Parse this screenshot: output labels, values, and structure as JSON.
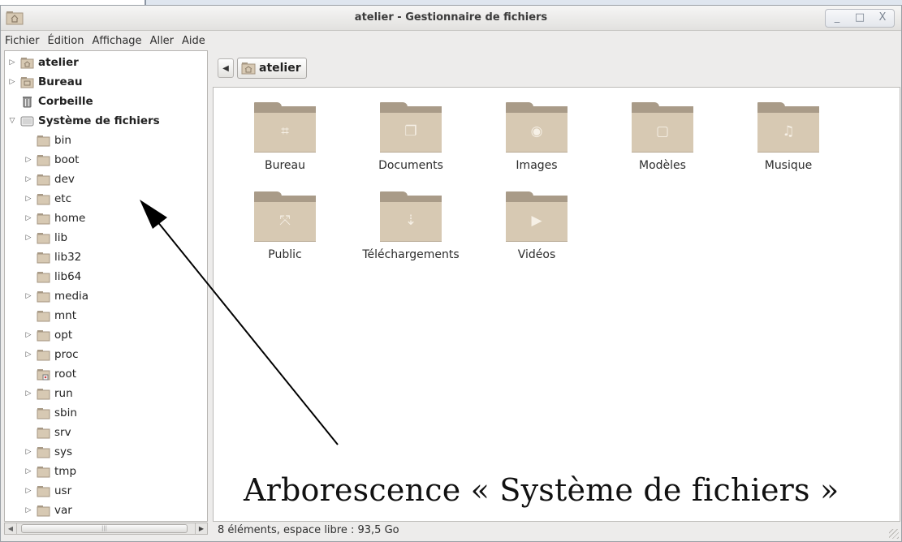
{
  "window": {
    "title": "atelier - Gestionnaire de fichiers",
    "buttons": [
      "_",
      "□",
      "X"
    ]
  },
  "menu": [
    "Fichier",
    "Édition",
    "Affichage",
    "Aller",
    "Aide"
  ],
  "tree": [
    {
      "label": "atelier",
      "expander": "▷",
      "bold": true,
      "icon": "home-folder-icon"
    },
    {
      "label": "Bureau",
      "expander": "▷",
      "bold": true,
      "icon": "desktop-folder-icon"
    },
    {
      "label": "Corbeille",
      "expander": "",
      "bold": true,
      "icon": "trash-icon"
    },
    {
      "label": "Système de fichiers",
      "expander": "▽",
      "bold": true,
      "icon": "drive-icon"
    },
    {
      "label": "bin",
      "expander": "",
      "icon": "folder-icon"
    },
    {
      "label": "boot",
      "expander": "▷",
      "icon": "folder-icon"
    },
    {
      "label": "dev",
      "expander": "▷",
      "icon": "folder-icon"
    },
    {
      "label": "etc",
      "expander": "▷",
      "icon": "folder-icon"
    },
    {
      "label": "home",
      "expander": "▷",
      "icon": "folder-icon"
    },
    {
      "label": "lib",
      "expander": "▷",
      "icon": "folder-icon"
    },
    {
      "label": "lib32",
      "expander": "",
      "icon": "folder-icon"
    },
    {
      "label": "lib64",
      "expander": "",
      "icon": "folder-icon"
    },
    {
      "label": "media",
      "expander": "▷",
      "icon": "folder-icon"
    },
    {
      "label": "mnt",
      "expander": "",
      "icon": "folder-icon"
    },
    {
      "label": "opt",
      "expander": "▷",
      "icon": "folder-icon"
    },
    {
      "label": "proc",
      "expander": "▷",
      "icon": "folder-icon"
    },
    {
      "label": "root",
      "expander": "",
      "icon": "locked-folder-icon"
    },
    {
      "label": "run",
      "expander": "▷",
      "icon": "folder-icon"
    },
    {
      "label": "sbin",
      "expander": "",
      "icon": "folder-icon"
    },
    {
      "label": "srv",
      "expander": "",
      "icon": "folder-icon"
    },
    {
      "label": "sys",
      "expander": "▷",
      "icon": "folder-icon"
    },
    {
      "label": "tmp",
      "expander": "▷",
      "icon": "folder-icon"
    },
    {
      "label": "usr",
      "expander": "▷",
      "icon": "folder-icon"
    },
    {
      "label": "var",
      "expander": "▷",
      "icon": "folder-icon"
    }
  ],
  "pathbar": {
    "back": "◀",
    "current": "atelier"
  },
  "files": [
    {
      "label": "Bureau",
      "emblem": "⌗",
      "icon": "desktop-folder-icon"
    },
    {
      "label": "Documents",
      "emblem": "❐",
      "icon": "documents-folder-icon"
    },
    {
      "label": "Images",
      "emblem": "◉",
      "icon": "pictures-folder-icon"
    },
    {
      "label": "Modèles",
      "emblem": "▢",
      "icon": "templates-folder-icon"
    },
    {
      "label": "Musique",
      "emblem": "♫",
      "icon": "music-folder-icon"
    },
    {
      "label": "Public",
      "emblem": "⤧",
      "icon": "public-folder-icon"
    },
    {
      "label": "Téléchargements",
      "emblem": "⇣",
      "icon": "downloads-folder-icon"
    },
    {
      "label": "Vidéos",
      "emblem": "▶",
      "icon": "videos-folder-icon"
    }
  ],
  "status": "8 éléments, espace libre : 93,5 Go",
  "annotation": "Arborescence « Système de fichiers »",
  "colors": {
    "folder": "#d7c9b3",
    "folder_dark": "#a99b88",
    "window_bg": "#edeceb"
  }
}
